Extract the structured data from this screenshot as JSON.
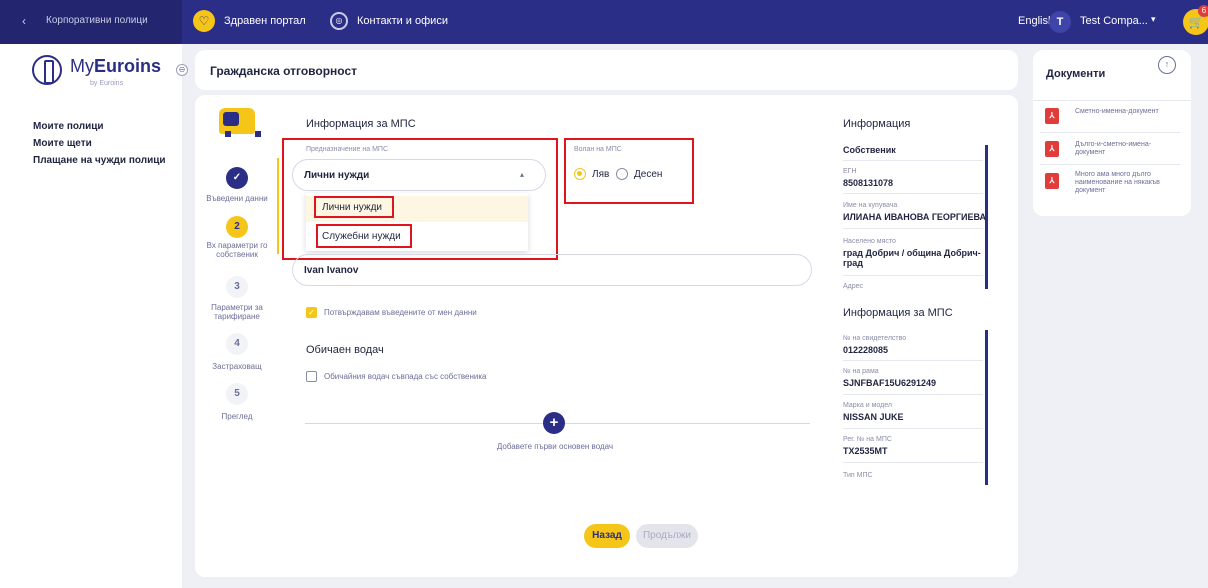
{
  "topbar": {
    "back": "‹",
    "corporate": "Корпоративни полици",
    "health_icon": "♡",
    "health": "Здравен портал",
    "contacts_icon": "◎",
    "contacts": "Контакти и офиси",
    "language": "English",
    "avatar": "T",
    "user": "Test Compa...",
    "caret": "▾",
    "cart_icon": "🛒",
    "cart_badge": "6"
  },
  "sidebar": {
    "logo_prefix": "My",
    "logo_brand": "Euroins",
    "logo_sub": "by Euroins",
    "collapse_icon": "⊖",
    "items": [
      "Моите полици",
      "Моите щети",
      "Плащане на чужди полици"
    ]
  },
  "page_title": "Гражданска отговорност",
  "stepper": {
    "steps": [
      {
        "badge": "✓",
        "label": "Въведени данни"
      },
      {
        "badge": "2",
        "label": "Вх параметри го собственик"
      },
      {
        "badge": "3",
        "label": "Параметри за тарифиране"
      },
      {
        "badge": "4",
        "label": "Застраховащ"
      },
      {
        "badge": "5",
        "label": "Преглед"
      }
    ]
  },
  "form": {
    "vehicle_section_title": "Информация за МПС",
    "purpose_label": "Предназначение на МПС",
    "purpose_value": "Лични нужди",
    "purpose_caret": "▴",
    "purpose_options": [
      "Лични нужди",
      "Служебни нужди"
    ],
    "steering_label": "Волан на МПС",
    "steering_options": [
      "Ляв",
      "Десен"
    ],
    "name_value": "Ivan Ivanov",
    "confirm_label": "Потвърждавам въведените от мен данни",
    "confirm_check": "✓",
    "driver_section_title": "Обичаен водач",
    "driver_checkbox_label": "Обичайния водач съвпада със собственика",
    "add_driver_icon": "+",
    "add_driver_label": "Добавете първи основен водач",
    "back_button": "Назад",
    "next_button": "Продължи"
  },
  "info": {
    "title": "Информация",
    "owner_heading": "Собственик",
    "egn_label": "ЕГН",
    "egn_value": "8508131078",
    "name_label": "Име на купувача",
    "name_value": "ИЛИАНА ИВАНОВА ГЕОРГИЕВА",
    "place_label": "Населено място",
    "place_value": "град Добрич / община Добрич-град",
    "address_label": "Адрес",
    "vehicle_title": "Информация за МПС",
    "cert_label": "№ на свидетелство",
    "cert_value": "012228085",
    "vin_label": "№ на рама",
    "vin_value": "SJNFBAF15U6291249",
    "make_label": "Марка и модел",
    "make_value": "NISSAN JUKE",
    "reg_label": "Рег. № на МПС",
    "reg_value": "TX2535MT",
    "type_label": "Тип МПС"
  },
  "documents": {
    "title": "Документи",
    "upload_icon": "↑",
    "items": [
      "Сметно-именна-документ",
      "Дълго-и-сметно-имена-документ",
      "Много ама много дълго наименование на някакъв документ"
    ],
    "pdf_icon": "⅄"
  },
  "colors": {
    "primary": "#2b2e86",
    "accent": "#f5c518",
    "highlight": "#e0141e"
  }
}
